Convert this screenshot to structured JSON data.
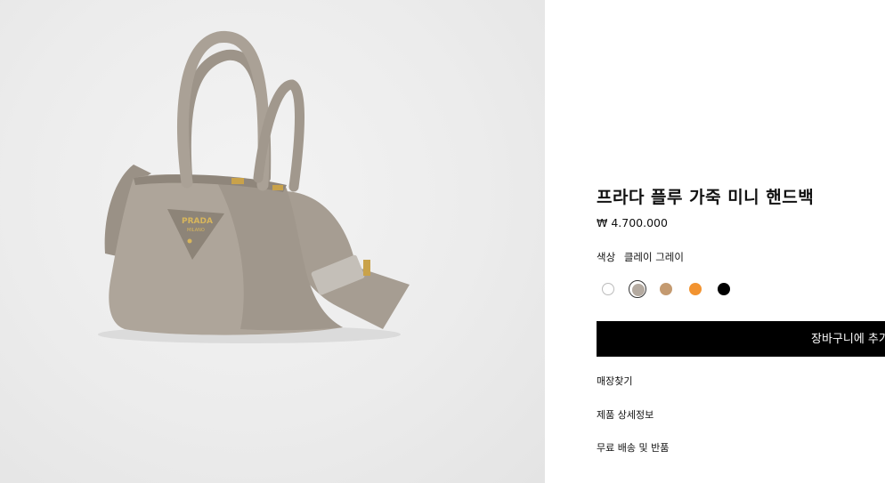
{
  "product": {
    "title": "프라다 플루 가죽 미니 핸드백",
    "price": "₩ 4.700.000",
    "color_label": "색상",
    "color_value": "클레이 그레이",
    "swatches": [
      {
        "name": "white",
        "color": "#ffffff",
        "selected": false
      },
      {
        "name": "clay-gray",
        "color": "#b4aaa0",
        "selected": true
      },
      {
        "name": "camel",
        "color": "#c49a70",
        "selected": false
      },
      {
        "name": "orange",
        "color": "#f29330",
        "selected": false
      },
      {
        "name": "black",
        "color": "#000000",
        "selected": false
      }
    ],
    "add_to_cart": "장바구니에 추가",
    "links": [
      "매장찾기",
      "제품 상세정보",
      "무료 배송 및 반품"
    ]
  },
  "image": {
    "logo_text": "PRADA",
    "logo_sub": "MILANO"
  }
}
